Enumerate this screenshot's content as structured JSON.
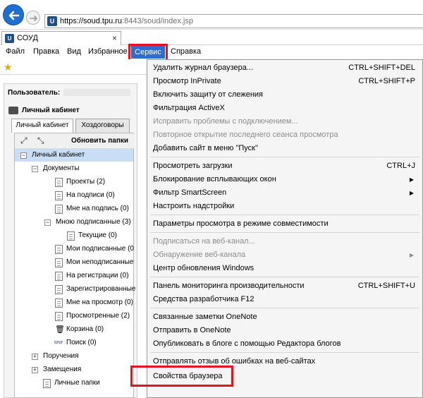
{
  "address_bar": {
    "url_host": "https://soud.tpu.ru",
    "url_rest": ":8443/soud/index.jsp",
    "favicon_letter": "U"
  },
  "tab": {
    "title": "СОУД",
    "favicon_letter": "U",
    "close_glyph": "×"
  },
  "menu_bar": {
    "items": [
      "Файл",
      "Правка",
      "Вид",
      "Избранное",
      "Сервис",
      "Справка"
    ]
  },
  "page": {
    "user_label": "Пользователь:",
    "cabinet_header": "Личный кабинет",
    "tabs": [
      "Личный кабинет",
      "Хоздоговоры"
    ],
    "refresh_label": "Обновить папки",
    "tree": [
      "Личный кабинет",
      "Документы",
      "Проекты (2)",
      "На подписи (0)",
      "Мне на подпись (0)",
      "Мною подписанные (3)",
      "Текущие (0)",
      "Мои подписанные (0",
      "Мои неподписанные",
      "На регистрации (0)",
      "Зарегистрированные",
      "Мне на просмотр (0)",
      "Просмотренные (2)",
      "Корзина (0)",
      "Поиск (0)",
      "Поручения",
      "Замещения",
      "Личные папки"
    ]
  },
  "dropdown": {
    "items": [
      {
        "label": "Удалить журнал браузера...",
        "shortcut": "CTRL+SHIFT+DEL"
      },
      {
        "label": "Просмотр InPrivate",
        "shortcut": "CTRL+SHIFT+P"
      },
      {
        "label": "Включить защиту от слежения",
        "shortcut": ""
      },
      {
        "label": "Фильтрация ActiveX",
        "shortcut": ""
      },
      {
        "label": "Исправить проблемы с подключением...",
        "shortcut": ""
      },
      {
        "label": "Повторное открытие последнего сеанса просмотра",
        "shortcut": ""
      },
      {
        "label": "Добавить сайт в меню \"Пуск\"",
        "shortcut": ""
      },
      {
        "label": "Просмотреть загрузки",
        "shortcut": "CTRL+J"
      },
      {
        "label": "Блокирование всплывающих окон",
        "shortcut": ""
      },
      {
        "label": "Фильтр SmartScreen",
        "shortcut": ""
      },
      {
        "label": "Настроить надстройки",
        "shortcut": ""
      },
      {
        "label": "Параметры просмотра в режиме совместимости",
        "shortcut": ""
      },
      {
        "label": "Подписаться на веб-канал...",
        "shortcut": ""
      },
      {
        "label": "Обнаружение веб-канала",
        "shortcut": ""
      },
      {
        "label": "Центр обновления Windows",
        "shortcut": ""
      },
      {
        "label": "Панель мониторинга производительности",
        "shortcut": "CTRL+SHIFT+U"
      },
      {
        "label": "Средства разработчика F12",
        "shortcut": ""
      },
      {
        "label": "Связанные заметки OneNote",
        "shortcut": ""
      },
      {
        "label": "Отправить в OneNote",
        "shortcut": ""
      },
      {
        "label": "Опубликовать в блоге с помощью Редактора блогов",
        "shortcut": ""
      },
      {
        "label": "Отправлять отзыв об ошибках на веб-сайтах",
        "shortcut": ""
      },
      {
        "label": "Свойства браузера",
        "shortcut": ""
      }
    ]
  },
  "colors": {
    "menu_highlight": "#2f6dcc",
    "annotation_red": "#e0151e",
    "back_button": "#1e6fd1"
  }
}
